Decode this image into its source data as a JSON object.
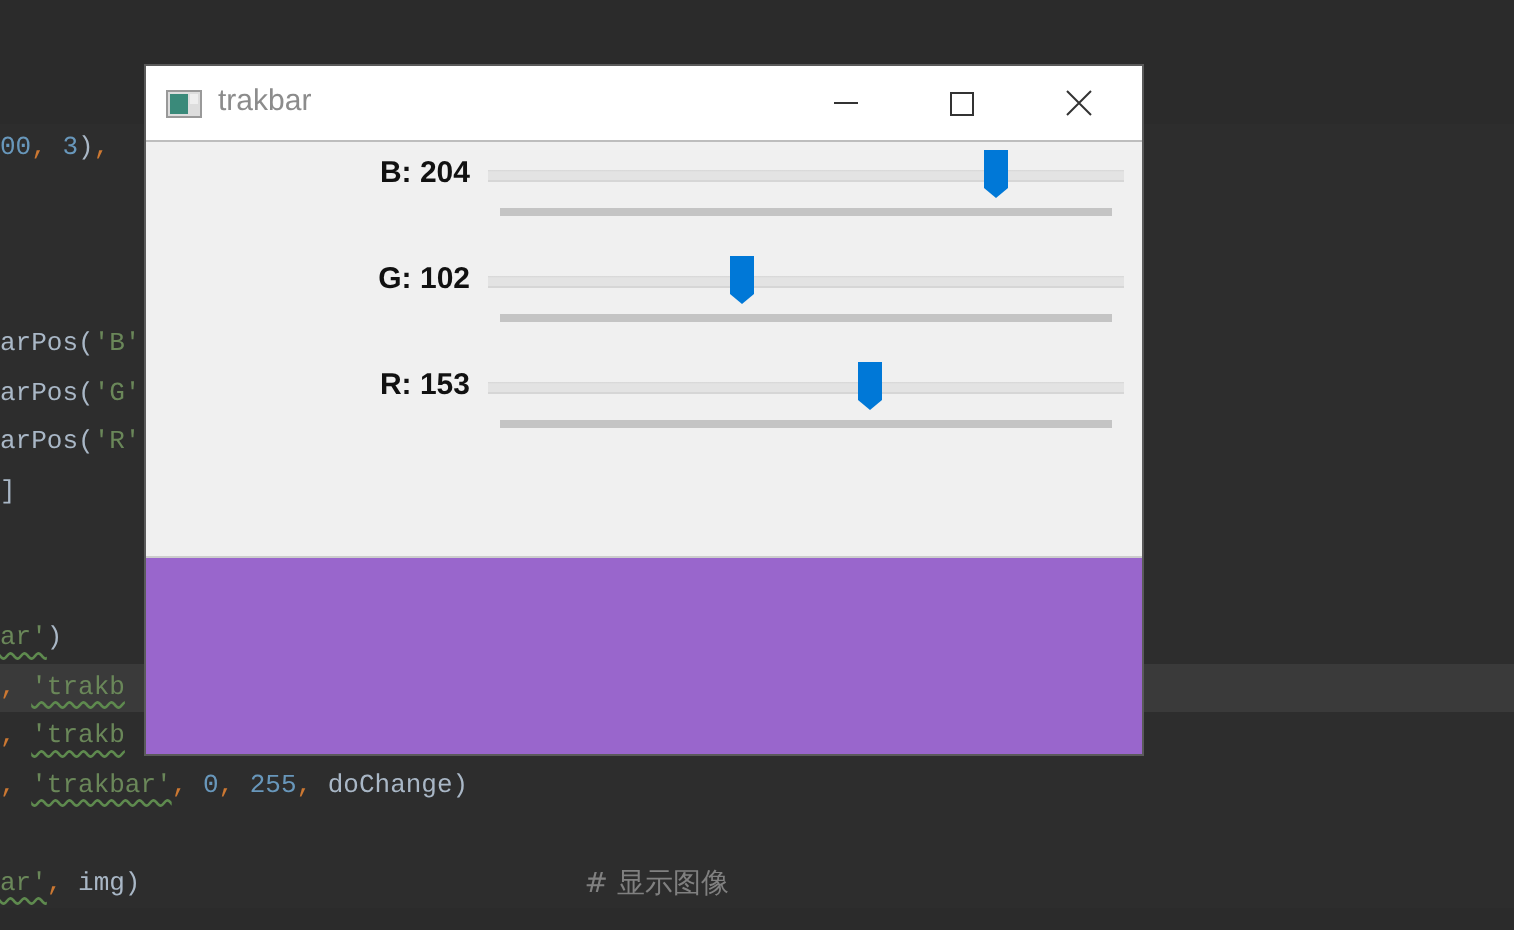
{
  "editor": {
    "lines": [
      {
        "segments": [
          {
            "text": "00",
            "kind": "number"
          },
          {
            "text": ", ",
            "kind": "punct"
          },
          {
            "text": "3",
            "kind": "number"
          },
          {
            "text": ")",
            "kind": "plain"
          },
          {
            "text": ",",
            "kind": "punct"
          }
        ],
        "current": false
      },
      {
        "segments": [
          {
            "text": "arPos(",
            "kind": "plain"
          },
          {
            "text": "'B'",
            "kind": "string"
          }
        ],
        "current": false
      },
      {
        "segments": [
          {
            "text": "arPos(",
            "kind": "plain"
          },
          {
            "text": "'G'",
            "kind": "string"
          }
        ],
        "current": false
      },
      {
        "segments": [
          {
            "text": "arPos(",
            "kind": "plain"
          },
          {
            "text": "'R'",
            "kind": "string"
          }
        ],
        "current": false
      },
      {
        "segments": [
          {
            "text": "]",
            "kind": "plain"
          }
        ],
        "current": false
      },
      {
        "segments": [
          {
            "text": "ar'",
            "kind": "typo"
          },
          {
            "text": ")",
            "kind": "plain"
          }
        ],
        "current": false
      },
      {
        "segments": [
          {
            "text": ", ",
            "kind": "punct"
          },
          {
            "text": "'trakb",
            "kind": "typo"
          }
        ],
        "current": true
      },
      {
        "segments": [
          {
            "text": ", ",
            "kind": "punct"
          },
          {
            "text": "'trakb",
            "kind": "typo"
          }
        ],
        "current": false
      },
      {
        "segments": [
          {
            "text": ", ",
            "kind": "punct"
          },
          {
            "text": "'trakbar'",
            "kind": "typo"
          },
          {
            "text": ", ",
            "kind": "punct"
          },
          {
            "text": "0",
            "kind": "number"
          },
          {
            "text": ", ",
            "kind": "punct"
          },
          {
            "text": "255",
            "kind": "number"
          },
          {
            "text": ", ",
            "kind": "punct"
          },
          {
            "text": "doChange)",
            "kind": "plain"
          }
        ],
        "current": false
      },
      {
        "segments": [
          {
            "text": "ar'",
            "kind": "typo"
          },
          {
            "text": ", ",
            "kind": "punct"
          },
          {
            "text": "img)",
            "kind": "plain"
          },
          {
            "text": "# 显示图像",
            "kind": "comment"
          }
        ],
        "current": false
      }
    ]
  },
  "window": {
    "title": "trakbar"
  },
  "trackbars": [
    {
      "label": "B: 204",
      "level": 0.8
    },
    {
      "label": "G: 102",
      "level": 0.4
    },
    {
      "label": "R: 153",
      "level": 0.6
    }
  ]
}
